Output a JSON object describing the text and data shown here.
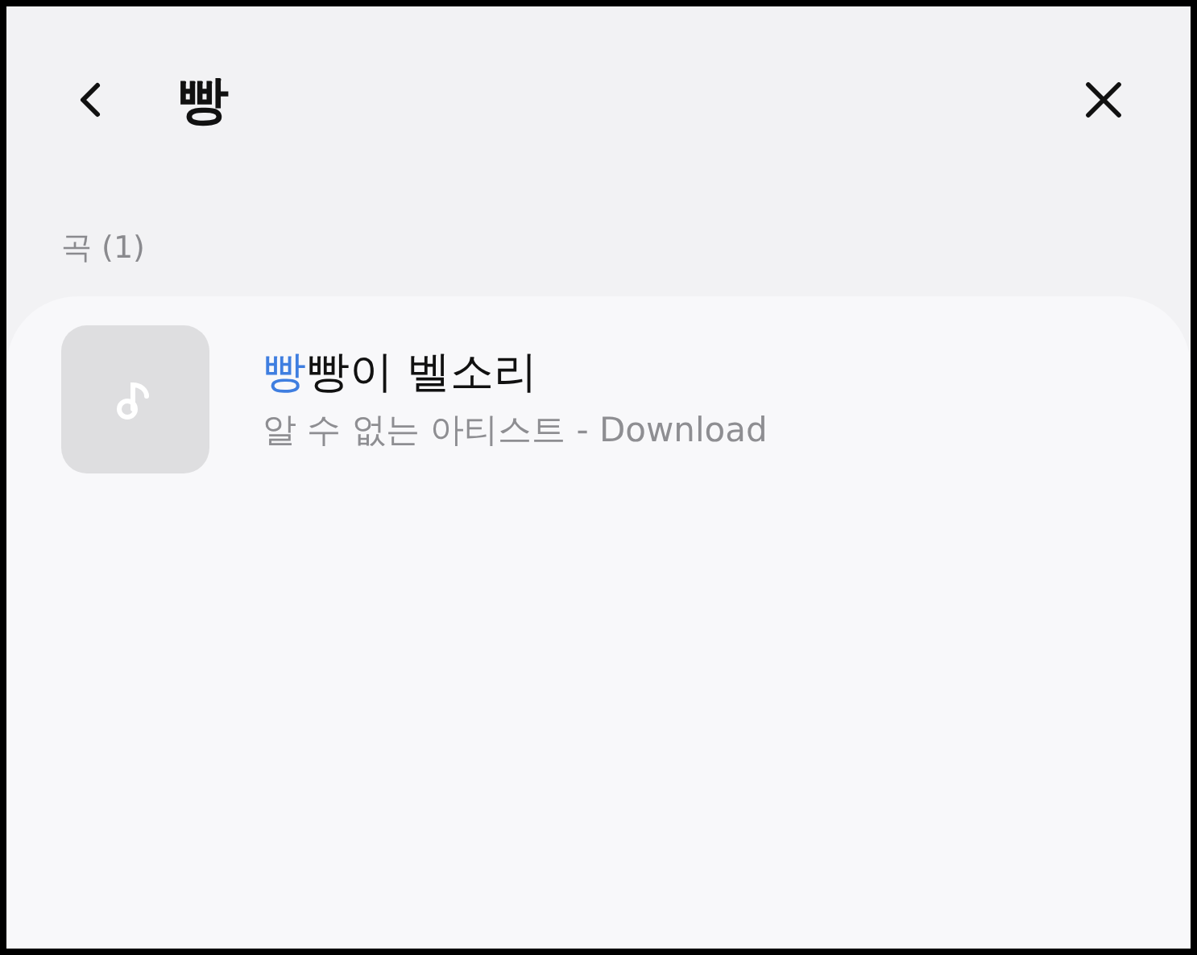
{
  "header": {
    "query": "빵"
  },
  "section": {
    "label": "곡 (1)"
  },
  "songs": [
    {
      "title_match": "빵",
      "title_rest": "빵이 벨소리",
      "subtitle": "알 수 없는 아티스트 - Download"
    }
  ]
}
